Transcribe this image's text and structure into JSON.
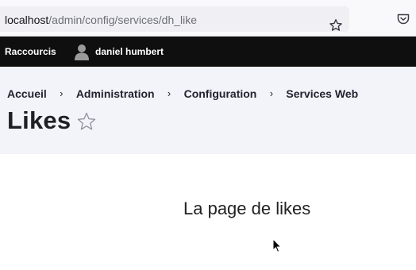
{
  "browser": {
    "url_host": "localhost",
    "url_path": "/admin/config/services/dh_like",
    "icons": {
      "bookmark": "star-outline-icon",
      "pocket": "pocket-icon"
    }
  },
  "toolbar": {
    "shortcuts_label": "Raccourcis",
    "user_name": "daniel humbert",
    "user_icon": "user-silhouette-icon"
  },
  "breadcrumb": [
    {
      "label": "Accueil"
    },
    {
      "label": "Administration"
    },
    {
      "label": "Configuration"
    },
    {
      "label": "Services Web"
    }
  ],
  "breadcrumb_separator": "›",
  "page": {
    "title": "Likes",
    "favorite_icon": "star-outline-icon",
    "content_text": "La page de likes"
  },
  "colors": {
    "toolbar_bg": "#0f0f0f",
    "header_bg": "#f3f4f9",
    "browser_bg": "#f9f9fb"
  }
}
